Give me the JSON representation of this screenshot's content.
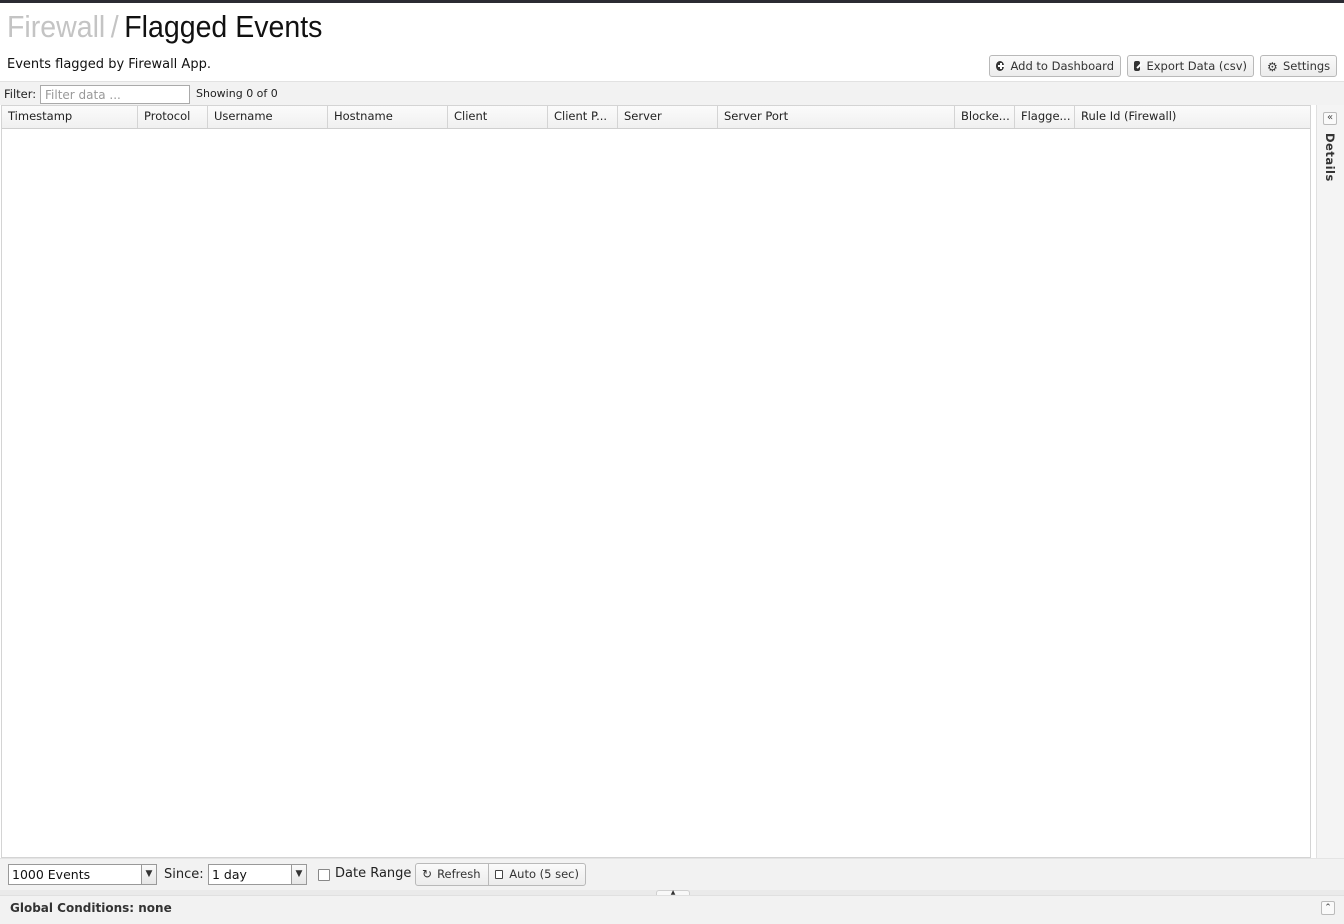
{
  "header": {
    "breadcrumb_parent": "Firewall",
    "breadcrumb_separator": "/",
    "title": "Flagged Events",
    "subtitle": "Events flagged by Firewall App."
  },
  "toolbar": {
    "add_dashboard_label": "Add to Dashboard",
    "export_label": "Export Data (csv)",
    "settings_label": "Settings"
  },
  "filter": {
    "label": "Filter:",
    "placeholder": "Filter data ...",
    "showing": "Showing 0 of 0"
  },
  "grid": {
    "columns": [
      "Timestamp",
      "Protocol",
      "Username",
      "Hostname",
      "Client",
      "Client P...",
      "Server",
      "Server Port",
      "Blocke...",
      "Flagge...",
      "Rule Id (Firewall)"
    ],
    "rows": []
  },
  "details_panel": {
    "label": "Details",
    "collapse_glyph": "«"
  },
  "bottom": {
    "events_select": "1000 Events",
    "since_label": "Since:",
    "since_select": "1 day",
    "date_range_label": "Date Range",
    "date_range_checked": false,
    "refresh_label": "Refresh",
    "auto_label": "Auto (5 sec)"
  },
  "global": {
    "text": "Global Conditions: none"
  },
  "colors": {
    "breadcrumb_muted": "#c4c4c4",
    "top_line": "#2b2b33",
    "bar_background": "#f2f2f2"
  },
  "icons": {
    "add_dashboard": "plus-circle-icon",
    "export": "external-link-icon",
    "settings": "gear-icon",
    "refresh": "refresh-icon",
    "auto": "checkbox-icon",
    "select_arrow": "chevron-down-icon",
    "global_toggle": "chevron-up-double-icon"
  }
}
